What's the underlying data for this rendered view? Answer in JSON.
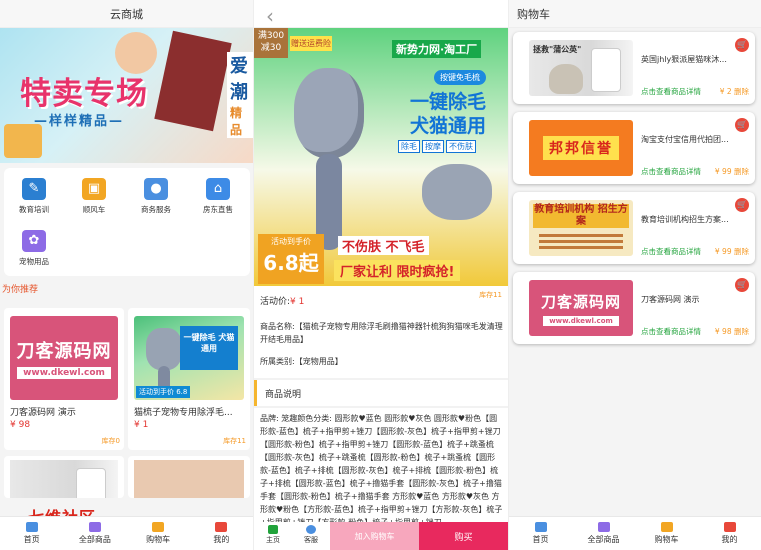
{
  "panel1": {
    "title": "云商城",
    "banner": {
      "title": "特卖专场",
      "subtitle": "—样样精品—",
      "side1": "爱潮",
      "side2": "精品"
    },
    "categories": [
      {
        "label": "教育培训",
        "icon": "education-icon",
        "color": "#2b7fd1"
      },
      {
        "label": "顺风车",
        "icon": "car-icon",
        "color": "#f2a623"
      },
      {
        "label": "商务服务",
        "icon": "business-icon",
        "color": "#4a8fe0"
      },
      {
        "label": "房东直售",
        "icon": "house-icon",
        "color": "#3d8be6"
      },
      {
        "label": "宠物用品",
        "icon": "paw-icon",
        "color": "#8d6be6"
      }
    ],
    "recommend_label": "为你推荐",
    "products": [
      {
        "name": "刀客源码网 演示",
        "price": "¥ 98",
        "stock": "库存0",
        "img_l1": "刀客源码网",
        "img_l2": "www.dkewl.com"
      },
      {
        "name": "猫梳子宠物专用除浮毛...",
        "price": "¥ 1",
        "stock": "库存11",
        "img_t": "一键除毛 犬猫通用",
        "img_p": "活动到手价 6.8"
      }
    ],
    "watermark": "七维社区",
    "tabs": [
      "首页",
      "全部商品",
      "购物车",
      "我的"
    ]
  },
  "panel2": {
    "back": "‹",
    "img": {
      "tag1": "满300减30",
      "tag2": "赠送运费险",
      "brand": "新势力网·淘工厂",
      "pill": "按键免毛梳",
      "big": "一键除毛 犬猫通用",
      "feats": [
        "除毛",
        "按摩",
        "不伤肤"
      ],
      "price_label": "活动到手价",
      "price": "6.8起",
      "slogan1": "不伤肤 不飞毛",
      "slogan2": "厂家让利 限时疯抢!"
    },
    "price_label": "活动价:",
    "price_value": "¥ 1",
    "stock": "库存11",
    "name": "商品名称:【猫梳子宠物专用除浮毛刷撸猫神器针梳狗狗猫咪毛发清理开结毛用品】",
    "category": "所属类别:【宠物用品】",
    "section_title": "商品说明",
    "desc": "品牌: 笼趣颜色分类: 圆形款♥蓝色 圆形款♥灰色 圆形款♥粉色【圆形款-蓝色】梳子+指甲剪+锉刀【圆形款-灰色】梳子+指甲剪+锉刀【圆形款-粉色】梳子+指甲剪+锉刀【圆形款-蓝色】梳子+跳蚤梳【圆形款-灰色】梳子+跳蚤梳【圆形款-粉色】梳子+跳蚤梳【圆形款-蓝色】梳子+排梳【圆形款-灰色】梳子+排梳【圆形款-粉色】梳子+排梳【圆形款-蓝色】梳子+撸猫手套【圆形款-灰色】梳子+撸猫手套【圆形款-粉色】梳子+撸猫手套 方形款♥蓝色 方形款♥灰色 方形款♥粉色【方形款-蓝色】梳子+指甲剪+锉刀【方形款-灰色】梳子+指甲剪+锉刀【方形款-粉色】梳子+指甲剪+锉刀",
    "bottom": {
      "home": "主页",
      "service": "客服",
      "add_cart": "加入购物车",
      "buy": "购买"
    }
  },
  "panel3": {
    "title": "购物车",
    "items": [
      {
        "name": "英国jhly狠派屋猫咪沐...",
        "detail": "点击查看商品详情",
        "price": "¥ 2 删除",
        "img": "cat",
        "img_text": "拯救\"蒲公英\""
      },
      {
        "name": "淘宝支付宝信用代拍团...",
        "detail": "点击查看商品详情",
        "price": "¥ 99 删除",
        "img": "bang",
        "img_text": "邦邦信誉"
      },
      {
        "name": "教育培训机构招生方案...",
        "detail": "点击查看商品详情",
        "price": "¥ 99 删除",
        "img": "edu",
        "img_text": "教育培训机构 招生方案"
      },
      {
        "name": "刀客源码网 演示",
        "detail": "点击查看商品详情",
        "price": "¥ 98 删除",
        "img": "logo",
        "img_text": "刀客源码网"
      }
    ],
    "img_sub": "www.dkewl.com",
    "tabs": [
      "首页",
      "全部商品",
      "购物车",
      "我的"
    ]
  },
  "colors": {
    "accent": "#e8295e",
    "price": "#e3342f",
    "stock": "#f59a27",
    "detail": "#21a33b"
  }
}
